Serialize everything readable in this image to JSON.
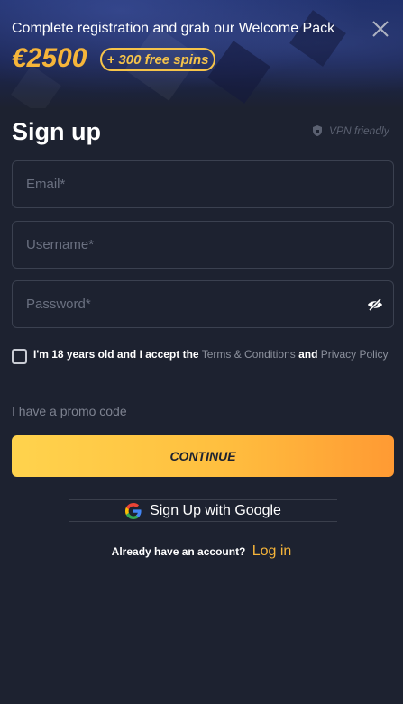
{
  "banner": {
    "headline": "Complete registration and grab our Welcome Pack",
    "amount": "€2500",
    "spins": "+ 300 free spins"
  },
  "form": {
    "title": "Sign up",
    "vpn_label": "VPN friendly",
    "email_placeholder": "Email*",
    "username_placeholder": "Username*",
    "password_placeholder": "Password*",
    "terms_prefix": "I'm 18 years old and I accept the",
    "terms_link": "Terms & Conditions",
    "terms_and": "and",
    "privacy_link": "Privacy Policy",
    "promo_label": "I have a promo code",
    "continue_label": "CONTINUE",
    "google_label": "Sign Up with Google",
    "have_account": "Already have an account?",
    "login_label": "Log in"
  },
  "colors": {
    "accent": "#f6b53a",
    "background": "#1d2230",
    "button_gradient_start": "#ffd34d",
    "button_gradient_end": "#ff9a33"
  },
  "icons": {
    "close": "close-icon",
    "vpn": "shield-icon",
    "password_toggle": "eye-off-icon",
    "google": "google-logo-icon"
  }
}
